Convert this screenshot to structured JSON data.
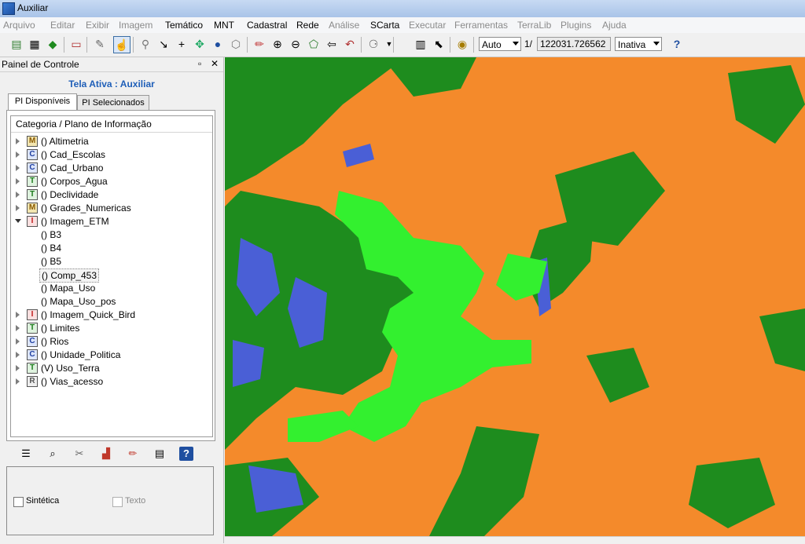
{
  "window": {
    "title": "Auxiliar"
  },
  "menu": [
    "Arquivo",
    "Editar",
    "Exibir",
    "Imagem",
    "Temático",
    "MNT",
    "Cadastral",
    "Rede",
    "Análise",
    "SCarta",
    "Executar",
    "Ferramentas",
    "TerraLib",
    "Plugins",
    "Ajuda"
  ],
  "toolbar": {
    "zoom_mode": "Auto",
    "scale_prefix": "1/",
    "scale_value": "122031.726562",
    "status_select": "Inativa",
    "icons": [
      "layers-icon",
      "grid-icon",
      "polygon-icon",
      "display-icon",
      "pointer-icon",
      "info-cursor-icon",
      "zoom-icon",
      "pan-arrow-icon",
      "crosshair-icon",
      "move-icon",
      "info-icon",
      "measure-icon",
      "pencil-icon",
      "zoom-in-icon",
      "zoom-out-icon",
      "zoom-area-icon",
      "back-icon",
      "undo-icon",
      "query-icon",
      "legend-icon",
      "select-cursor-icon",
      "palette-icon",
      "help-icon"
    ]
  },
  "panel": {
    "title": "Painel de Controle",
    "active_screen": "Tela Ativa : Auxiliar",
    "tabs": [
      "PI Disponíveis",
      "PI Selecionados"
    ],
    "tree_header": "Categoria / Plano de Informação",
    "tree": [
      {
        "badge": "M",
        "label": "() Altimetria",
        "open": false
      },
      {
        "badge": "C",
        "label": "() Cad_Escolas",
        "open": false
      },
      {
        "badge": "C",
        "label": "() Cad_Urbano",
        "open": false
      },
      {
        "badge": "T",
        "label": "() Corpos_Agua",
        "open": false
      },
      {
        "badge": "T",
        "label": "() Declividade",
        "open": false
      },
      {
        "badge": "M",
        "label": "() Grades_Numericas",
        "open": false
      },
      {
        "badge": "I",
        "label": "() Imagem_ETM",
        "open": true
      },
      {
        "badge": "I",
        "label": "() Imagem_Quick_Bird",
        "open": false
      },
      {
        "badge": "T",
        "label": "() Limites",
        "open": false
      },
      {
        "badge": "C",
        "label": "() Rios",
        "open": false
      },
      {
        "badge": "C",
        "label": "() Unidade_Politica",
        "open": false
      },
      {
        "badge": "T",
        "label": "(V) Uso_Terra",
        "open": false
      },
      {
        "badge": "R",
        "label": "() Vias_acesso",
        "open": false
      }
    ],
    "children": [
      "() B3",
      "() B4",
      "() B5",
      "() Comp_453",
      "() Mapa_Uso",
      "() Mapa_Uso_pos"
    ],
    "selected_child": "() Comp_453",
    "options": {
      "synthetic": "Sintética",
      "text": "Texto"
    }
  },
  "map": {
    "colors": {
      "urban": "#f48a2b",
      "vegetation": "#1e8c1e",
      "lake": "#33f02f",
      "water": "#4a5fd6"
    }
  }
}
